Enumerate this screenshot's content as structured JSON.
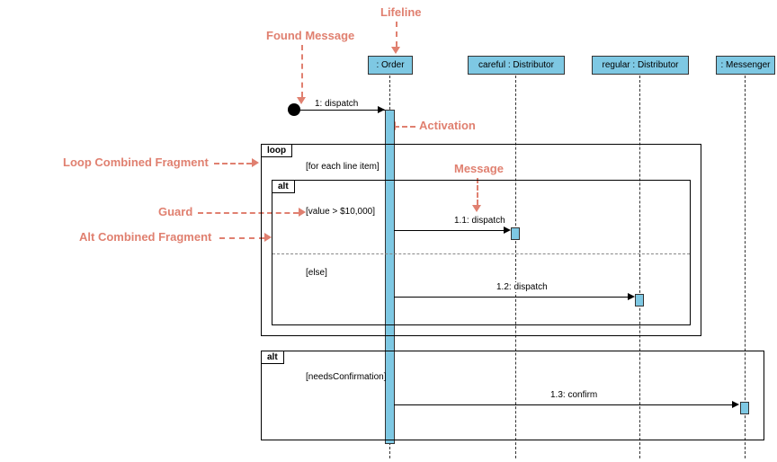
{
  "annotations": {
    "lifeline": "Lifeline",
    "found_message": "Found Message",
    "activation": "Activation",
    "loop_fragment": "Loop Combined Fragment",
    "message": "Message",
    "guard": "Guard",
    "alt_fragment": "Alt Combined Fragment"
  },
  "lifelines": {
    "order": ": Order",
    "careful": "careful : Distributor",
    "regular": "regular : Distributor",
    "messenger": ": Messenger"
  },
  "fragments": {
    "loop": {
      "label": "loop",
      "guard": "[for each line item]"
    },
    "alt1": {
      "label": "alt",
      "guard1": "[value > $10,000]",
      "guard2": "[else]"
    },
    "alt2": {
      "label": "alt",
      "guard": "[needsConfirmation]"
    }
  },
  "messages": {
    "m1": "1: dispatch",
    "m11": "1.1: dispatch",
    "m12": "1.2: dispatch",
    "m13": "1.3: confirm"
  },
  "chart_data": {
    "type": "sequence_diagram",
    "lifelines": [
      {
        "id": "order",
        "name": "Order",
        "role": ""
      },
      {
        "id": "careful",
        "name": "Distributor",
        "role": "careful"
      },
      {
        "id": "regular",
        "name": "Distributor",
        "role": "regular"
      },
      {
        "id": "messenger",
        "name": "Messenger",
        "role": ""
      }
    ],
    "messages": [
      {
        "seq": "1",
        "label": "dispatch",
        "from": "found",
        "to": "order",
        "type": "found"
      },
      {
        "seq": "1.1",
        "label": "dispatch",
        "from": "order",
        "to": "careful"
      },
      {
        "seq": "1.2",
        "label": "dispatch",
        "from": "order",
        "to": "regular"
      },
      {
        "seq": "1.3",
        "label": "confirm",
        "from": "order",
        "to": "messenger"
      }
    ],
    "fragments": [
      {
        "type": "loop",
        "guard": "for each line item",
        "contains": [
          "1.1",
          "1.2"
        ]
      },
      {
        "type": "alt",
        "operands": [
          {
            "guard": "value > $10,000",
            "contains": [
              "1.1"
            ]
          },
          {
            "guard": "else",
            "contains": [
              "1.2"
            ]
          }
        ]
      },
      {
        "type": "alt",
        "operands": [
          {
            "guard": "needsConfirmation",
            "contains": [
              "1.3"
            ]
          }
        ]
      }
    ],
    "annotations": [
      "Lifeline",
      "Found Message",
      "Activation",
      "Loop Combined Fragment",
      "Message",
      "Guard",
      "Alt Combined Fragment"
    ]
  }
}
